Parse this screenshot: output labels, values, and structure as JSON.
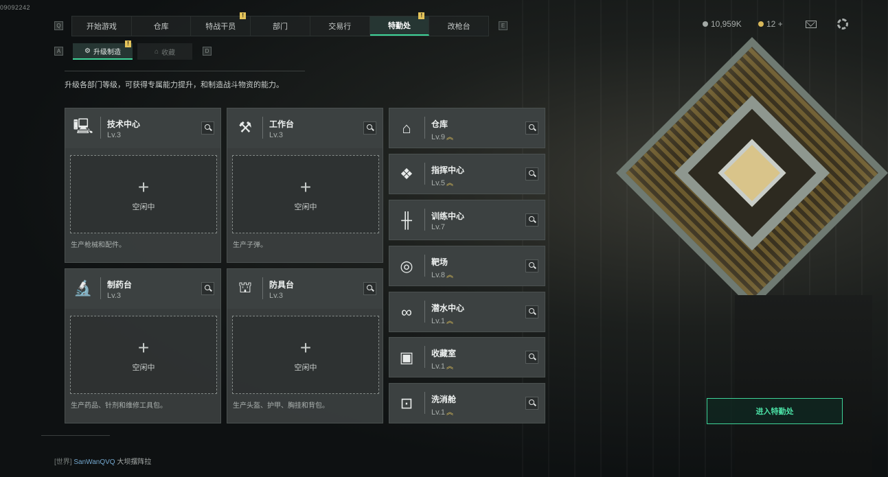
{
  "version": "09092242",
  "nav": {
    "key_left": "Q",
    "key_right": "E",
    "tabs": [
      {
        "label": "开始游戏",
        "badge": ""
      },
      {
        "label": "仓库",
        "badge": ""
      },
      {
        "label": "特战干员",
        "badge": "!"
      },
      {
        "label": "部门",
        "badge": ""
      },
      {
        "label": "交易行",
        "badge": ""
      },
      {
        "label": "特勤处",
        "badge": "!"
      },
      {
        "label": "改枪台",
        "badge": ""
      }
    ]
  },
  "currency": {
    "money": "10,959K",
    "tokens": "12 +"
  },
  "subnav": {
    "key_left": "A",
    "key_right": "D",
    "active": {
      "label": "升级制造",
      "badge": "!"
    },
    "inactive": {
      "label": "收藏"
    }
  },
  "description": "升级各部门等级，可获得专属能力提升，和制造战斗物资的能力。",
  "facilities": [
    {
      "name": "技术中心",
      "level": "Lv.3",
      "slot": "空闲中",
      "footer": "生产枪械和配件。",
      "icon": "computer-icon"
    },
    {
      "name": "工作台",
      "level": "Lv.3",
      "slot": "空闲中",
      "footer": "生产子弹。",
      "icon": "tools-icon"
    },
    {
      "name": "制药台",
      "level": "Lv.3",
      "slot": "空闲中",
      "footer": "生产药品、针剂和维修工具包。",
      "icon": "microscope-icon"
    },
    {
      "name": "防具台",
      "level": "Lv.3",
      "slot": "空闲中",
      "footer": "生产头盔、护甲、胸挂和背包。",
      "icon": "armor-icon"
    }
  ],
  "departments": [
    {
      "name": "仓库",
      "level": "Lv.9",
      "upgrade": "︽",
      "icon": "warehouse-icon"
    },
    {
      "name": "指挥中心",
      "level": "Lv.5",
      "upgrade": "︽",
      "icon": "command-icon"
    },
    {
      "name": "训练中心",
      "level": "Lv.7",
      "upgrade": "",
      "icon": "dumbbell-icon"
    },
    {
      "name": "靶场",
      "level": "Lv.8",
      "upgrade": "︽",
      "icon": "target-icon"
    },
    {
      "name": "潜水中心",
      "level": "Lv.1",
      "upgrade": "︽",
      "icon": "diving-icon"
    },
    {
      "name": "收藏室",
      "level": "Lv.1",
      "upgrade": "︽",
      "icon": "collection-icon"
    },
    {
      "name": "洗消舱",
      "level": "Lv.1",
      "upgrade": "︽",
      "icon": "decon-icon"
    }
  ],
  "enter_button": "进入特勤处",
  "chat": {
    "channel": "[世界]",
    "user": "SanWanQVQ",
    "message": "大坝摆阵拉"
  },
  "colors": {
    "accent": "#3fd69a",
    "badge": "#e3c35a"
  }
}
